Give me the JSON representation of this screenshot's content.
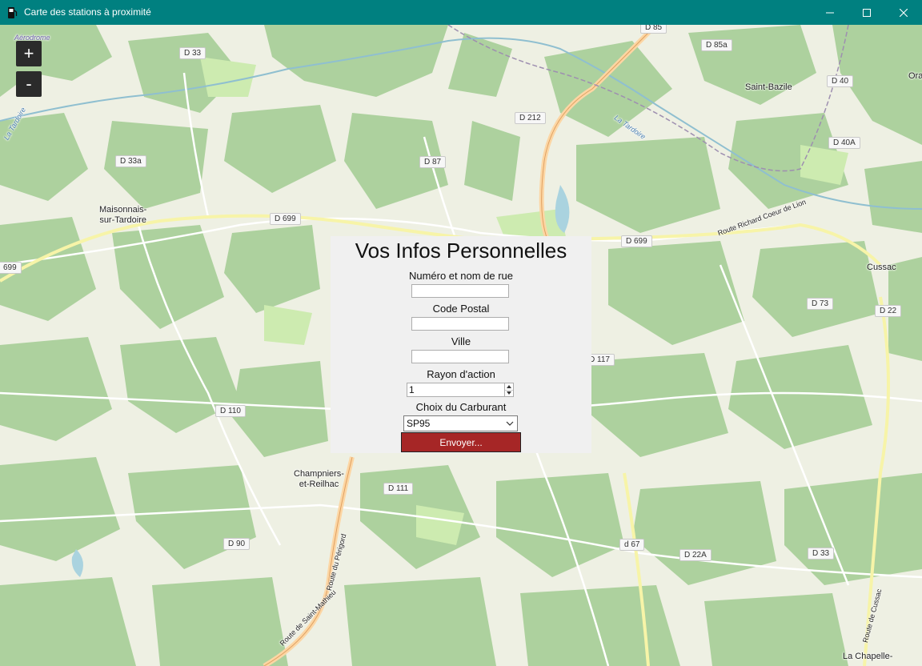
{
  "window": {
    "title": "Carte des stations à proximité",
    "icon": "fuel-pump-icon",
    "controls": [
      "minimize-icon",
      "maximize-icon",
      "close-icon"
    ]
  },
  "map": {
    "zoom_in_label": "+",
    "zoom_out_label": "-",
    "road_labels": [
      "D 85",
      "D 85a",
      "D 33",
      "D 40",
      "D 212",
      "D 40A",
      "D 33a",
      "D 87",
      "D 699",
      "D 699",
      "699",
      "D 73",
      "D 22",
      "D 117",
      "D 110",
      "D 111",
      "D 90",
      "d 67",
      "D 22A",
      "D 33"
    ],
    "place_labels": {
      "maisonnais": "Maisonnais-\nsur-Tardoire",
      "saint_bazile": "Saint-Bazile",
      "cussac": "Cussac",
      "champniers": "Champniers-\net-Reilhac",
      "la_chapelle": "La Chapelle-",
      "ora": "Ora",
      "aerodrome": "Aérodrome"
    },
    "street_labels": {
      "la_tardoire_w": "La Tardoire",
      "la_tardoire_e": "La Tardoire",
      "route_richard": "Route Richard Coeur de Lion",
      "route_perigord": "Route du Périgord",
      "route_saint_mathieu": "Route de Saint-Mathieu",
      "route_cussac": "Route de Cussac"
    }
  },
  "form": {
    "title": "Vos Infos Personnelles",
    "street_label": "Numéro et nom de rue",
    "street_value": "",
    "postal_label": "Code Postal",
    "postal_value": "",
    "city_label": "Ville",
    "city_value": "",
    "radius_label": "Rayon d'action",
    "radius_value": "1",
    "fuel_label": "Choix du Carburant",
    "fuel_value": "SP95",
    "submit_label": "Envoyer...",
    "submit_color": "#a62626"
  }
}
